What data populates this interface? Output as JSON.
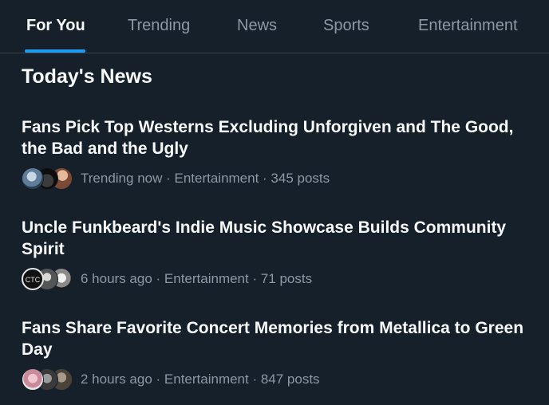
{
  "tabs": [
    {
      "label": "For You",
      "active": true
    },
    {
      "label": "Trending",
      "active": false
    },
    {
      "label": "News",
      "active": false
    },
    {
      "label": "Sports",
      "active": false
    },
    {
      "label": "Entertainment",
      "active": false
    }
  ],
  "section": {
    "title": "Today's News"
  },
  "stories": [
    {
      "title": "Fans Pick Top Westerns Excluding Unforgiven and The Good, the Bad and the Ugly",
      "meta": "Trending now · Entertainment · 345 posts"
    },
    {
      "title": "Uncle Funkbeard's Indie Music Showcase Builds Community Spirit",
      "meta": "6 hours ago · Entertainment · 71 posts"
    },
    {
      "title": "Fans Share Favorite Concert Memories from Metallica to Green Day",
      "meta": "2 hours ago · Entertainment · 847 posts"
    }
  ],
  "colors": {
    "background": "#15202b",
    "accent": "#1d9bf0",
    "text_primary": "#f7f9f9",
    "text_secondary": "#8b98a5"
  }
}
